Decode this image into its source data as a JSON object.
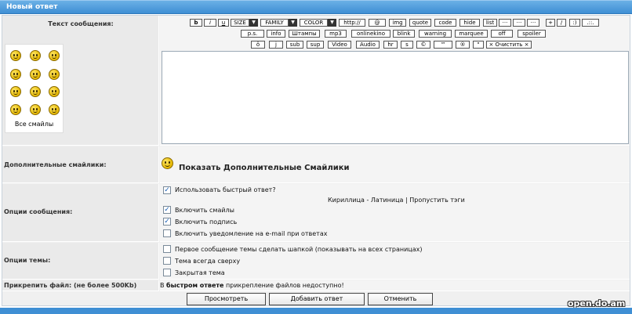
{
  "header": {
    "title": "Новый ответ"
  },
  "labels": {
    "message_text": "Текст сообщения:",
    "extra_smilies": "Дополнительные смайлики:",
    "message_options": "Опции сообщения:",
    "topic_options": "Опции темы:",
    "attach": "Прикрепить файл: (не более 500Kb)"
  },
  "smilies": {
    "all_label": "Все смайлы"
  },
  "toolbar": {
    "row1": [
      "b",
      "i",
      "u",
      "SIZE",
      "FAMILY",
      "COLOR",
      "http://",
      "@",
      "img",
      "quote",
      "code",
      "hide",
      "list",
      "···",
      "···",
      "···",
      "+",
      "/",
      ":)",
      ".::."
    ],
    "row2": [
      "p.s.",
      "info",
      "Штампы",
      "mp3",
      "onlinekino",
      "blink",
      "warning",
      "marquee",
      "off",
      "spoiler"
    ],
    "row3": [
      "ö",
      "j",
      "sub",
      "sup",
      "Video",
      "Audio",
      "hr",
      "s",
      "©",
      "™",
      "®",
      "\"",
      "× Очистить ×"
    ]
  },
  "extra": {
    "show_label": "Показать Дополнительные Смайлики"
  },
  "message_options": {
    "fast_reply": "Использовать быстрый ответ?",
    "translit": "Кириллица - Латиница | Пропустить тэги",
    "enable_smilies": "Включить смайлы",
    "enable_signature": "Включить подпись",
    "email_notify": "Включить уведомление на e-mail при ответах"
  },
  "topic_options": {
    "header_post": "Первое сообщение темы сделать шапкой (показывать на всех страницах)",
    "always_top": "Тема всегда сверху",
    "closed": "Закрытая тема"
  },
  "attach": {
    "prefix": "В",
    "bold": "быстром ответе",
    "suffix": "прикрепление файлов недоступно!"
  },
  "buttons": {
    "preview": "Просмотреть",
    "submit": "Добавить ответ",
    "cancel": "Отменить"
  },
  "watermark": "open.do.am",
  "checkbox_states": {
    "fast_reply": true,
    "enable_smilies": true,
    "enable_signature": true,
    "email_notify": false,
    "header_post": false,
    "always_top": false,
    "closed": false
  }
}
